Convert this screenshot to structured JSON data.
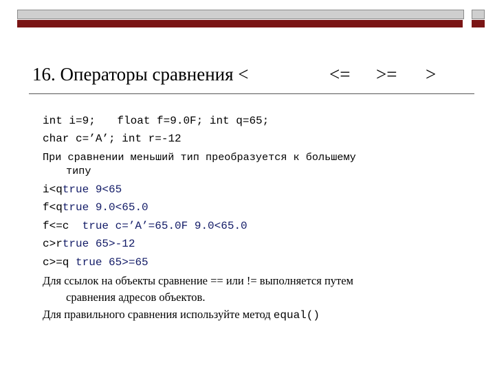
{
  "slide": {
    "title": {
      "text": "16. Операторы сравнения <",
      "op_le": "<=",
      "op_ge": ">=",
      "op_gt": ">"
    },
    "lines": [
      {
        "a": "int i=9;",
        "b": "float f=9.0F; int q=65;"
      },
      {
        "a": "char c=’A’;",
        "b": "int r=-12"
      },
      {
        "a": "При сравнении меньший тип преобразуется к большему",
        "b": "типу"
      },
      {
        "a": "i<q",
        "b": "true",
        "c": "9<65"
      },
      {
        "a": "f<q",
        "b": "true",
        "c": "9.0<65.0"
      },
      {
        "a": "f<=c",
        "b": "true",
        "c": "c=’A’=65.0F 9.0<65.0"
      },
      {
        "a": "c>r",
        "b": "true",
        "c": "65>-12"
      },
      {
        "a": "c>=q",
        "b": "true",
        "c": "65>=65"
      },
      {
        "a": "Для ссылок на объекты сравнение == или != выполняется путем",
        "b": "сравнения адресов объектов."
      },
      {
        "a": "Для правильного сравнения используйте метод",
        "b": "equal()"
      }
    ]
  }
}
